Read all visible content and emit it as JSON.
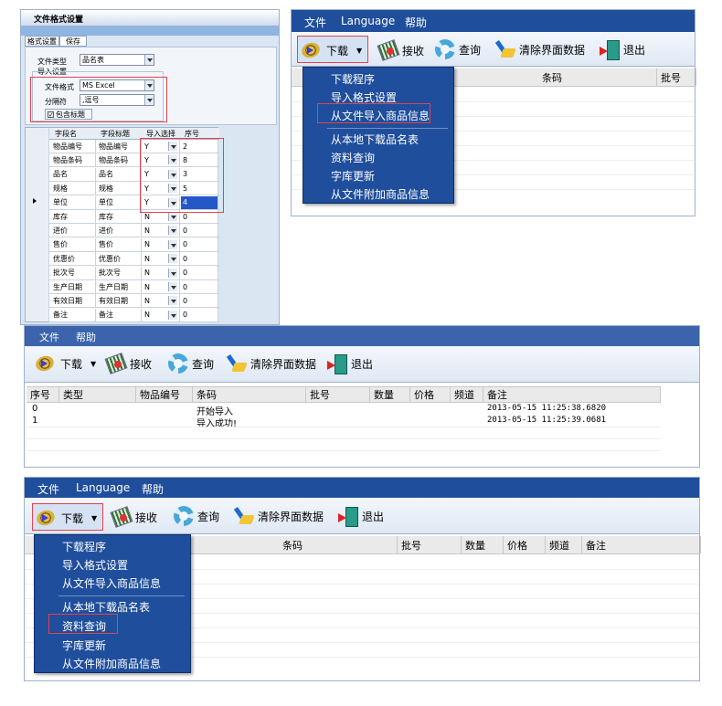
{
  "panel1": {
    "title": "文件格式设置",
    "tabs": [
      "格式设置",
      "保存"
    ],
    "file_type_label": "文件类型",
    "file_type_value": "品名表",
    "group_label": "导入设置",
    "file_format_label": "文件格式",
    "file_format_value": "MS Excel",
    "delimiter_label": "分隔符",
    "delimiter_value": ",逗号",
    "include_header_label": "包含标题",
    "columns": [
      "字段名",
      "字段标题",
      "导入选择",
      "序号"
    ],
    "rows": [
      {
        "field": "物品编号",
        "title": "物品编号",
        "sel": "Y",
        "seq": "2"
      },
      {
        "field": "物品条码",
        "title": "物品条码",
        "sel": "Y",
        "seq": "8"
      },
      {
        "field": "品名",
        "title": "品名",
        "sel": "Y",
        "seq": "3"
      },
      {
        "field": "规格",
        "title": "规格",
        "sel": "Y",
        "seq": "5"
      },
      {
        "field": "单位",
        "title": "单位",
        "sel": "Y",
        "seq": "4"
      },
      {
        "field": "库存",
        "title": "库存",
        "sel": "N",
        "seq": "0"
      },
      {
        "field": "进价",
        "title": "进价",
        "sel": "N",
        "seq": "0"
      },
      {
        "field": "售价",
        "title": "售价",
        "sel": "N",
        "seq": "0"
      },
      {
        "field": "优惠价",
        "title": "优惠价",
        "sel": "N",
        "seq": "0"
      },
      {
        "field": "批次号",
        "title": "批次号",
        "sel": "N",
        "seq": "0"
      },
      {
        "field": "生产日期",
        "title": "生产日期",
        "sel": "N",
        "seq": "0"
      },
      {
        "field": "有效日期",
        "title": "有效日期",
        "sel": "N",
        "seq": "0"
      },
      {
        "field": "备注",
        "title": "备注",
        "sel": "N",
        "seq": "0"
      }
    ]
  },
  "menus": {
    "file": "文件",
    "language": "Language",
    "help": "帮助"
  },
  "toolbar": {
    "download": "下载",
    "receive": "接收",
    "query": "查询",
    "clear": "清除界面数据",
    "exit": "退出"
  },
  "dropdown_items": [
    "下载程序",
    "导入格式设置",
    "从文件导入商品信息",
    "从本地下载品名表",
    "资料查询",
    "字库更新",
    "从文件附加商品信息"
  ],
  "panel2": {
    "columns": [
      "条码",
      "批号"
    ]
  },
  "panel3": {
    "columns": [
      "序号",
      "类型",
      "物品编号",
      "条码",
      "批号",
      "数量",
      "价格",
      "频道",
      "备注"
    ],
    "rows": [
      {
        "seq": "0",
        "code": "开始导入",
        "time": "2013-05-15 11:25:38.6820"
      },
      {
        "seq": "1",
        "code": "导入成功!",
        "time": "2013-05-15 11:25:39.0681"
      }
    ]
  },
  "panel4": {
    "columns": [
      "条码",
      "批号",
      "数量",
      "价格",
      "频道",
      "备注"
    ]
  }
}
